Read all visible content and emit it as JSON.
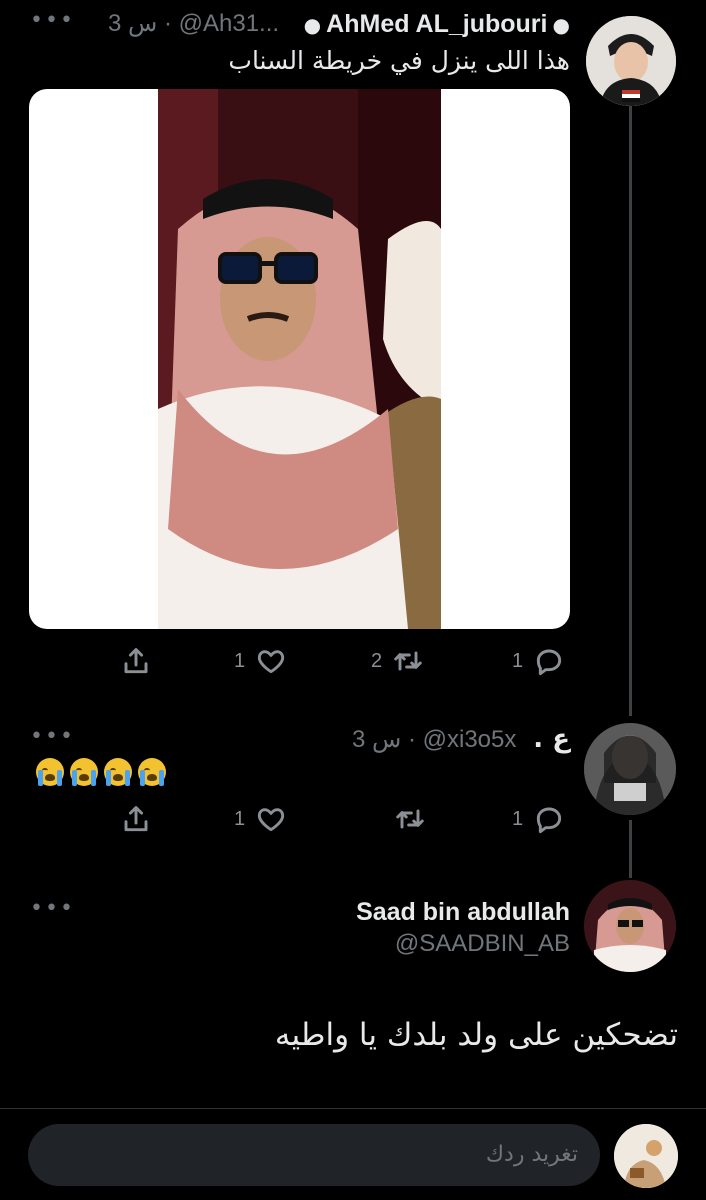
{
  "colors": {
    "background": "#000000",
    "text": "#e7e9ea",
    "secondary": "#71767b",
    "thread_line": "#3e4144",
    "compose_bg": "#202327"
  },
  "tweet1": {
    "name": "AhMed AL_jubouri",
    "handle_time": "3 س · @Ah31...",
    "text": "هذا اللى ينزل في خريطة السناب",
    "more": "•••",
    "actions": {
      "reply_count": "1",
      "retweet_count": "2",
      "like_count": "1"
    }
  },
  "tweet2": {
    "name": "ع .",
    "handle_time": "3 س · @xi3o5x",
    "emoji_count": 4,
    "more": "•••",
    "actions": {
      "reply_count": "1",
      "like_count": "1"
    }
  },
  "tweet3": {
    "name": "Saad bin abdullah",
    "handle": "@SAADBIN_AB",
    "text": "تضحكين على ولد بلدك يا واطيه",
    "more": "•••"
  },
  "compose": {
    "placeholder": "تغريد ردك"
  },
  "icons": [
    "verified-apple-icon",
    "reply-icon",
    "retweet-icon",
    "like-icon",
    "share-icon",
    "more-icon"
  ]
}
